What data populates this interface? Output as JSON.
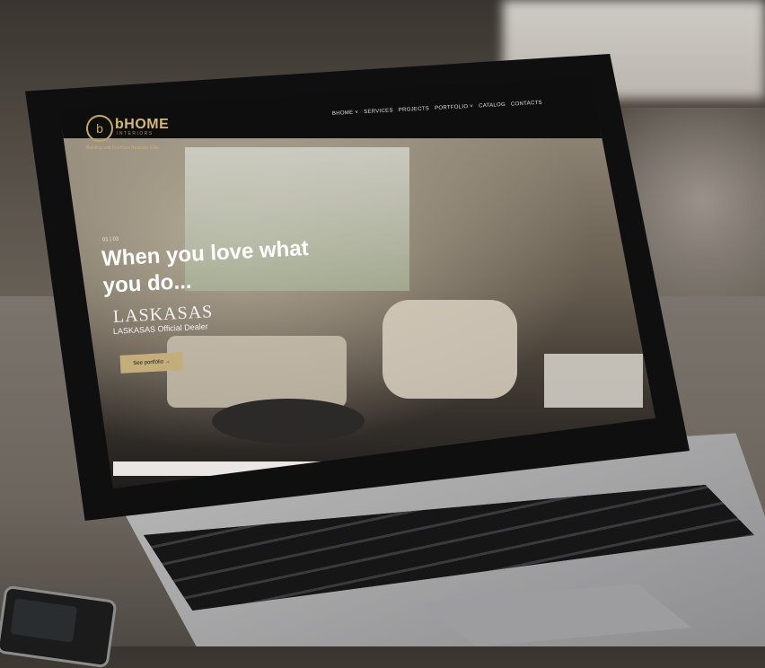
{
  "site": {
    "logo_mark": "b",
    "logo_text": "bHOME",
    "logo_sub": "INTERIORS",
    "tagline": "Building and Furniture Bespoke Elite"
  },
  "nav": {
    "items": [
      "BHOME ˅",
      "SERVICES",
      "PROJECTS",
      "PORTFOLIO ˅",
      "CATALOG",
      "CONTACTS"
    ]
  },
  "hero": {
    "slide_indicator": "01 | 03",
    "headline": "When you love what you do...",
    "brand": "LASKASAS",
    "brand_sub": "LASKASAS Official Dealer",
    "cta_label": "See portfolio →"
  }
}
